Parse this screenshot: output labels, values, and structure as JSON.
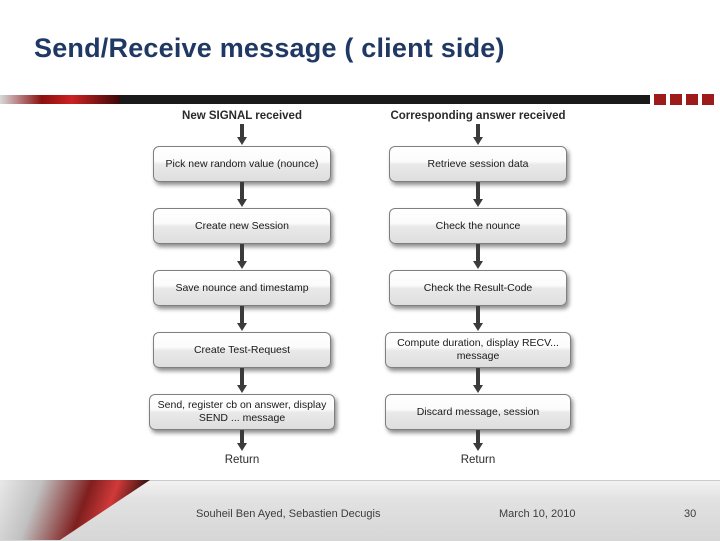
{
  "slide": {
    "title": "Send/Receive message ( client side)"
  },
  "diagram": {
    "left_column": {
      "header": "New SIGNAL received",
      "steps": [
        "Pick new random value (nounce)",
        "Create new Session",
        "Save nounce and timestamp",
        "Create Test-Request",
        "Send, register cb on answer, display SEND ... message"
      ],
      "return_label": "Return"
    },
    "right_column": {
      "header": "Corresponding answer received",
      "steps": [
        "Retrieve session data",
        "Check the nounce",
        "Check the Result-Code",
        "Compute duration, display RECV... message",
        "Discard message, session"
      ],
      "return_label": "Return"
    }
  },
  "footer": {
    "author": "Souheil Ben Ayed, Sebastien Decugis",
    "date": "March 10, 2010",
    "page": "30"
  }
}
